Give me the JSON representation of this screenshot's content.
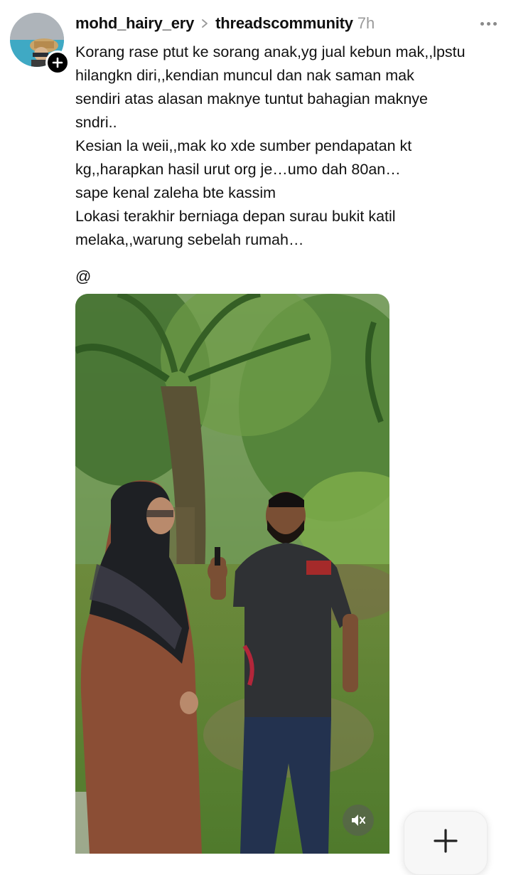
{
  "post": {
    "username": "mohd_hairy_ery",
    "community": "threadscommunity",
    "time": "7h",
    "text": "Korang rase ptut ke sorang anak,yg jual kebun mak,,lpstu\nhilangkn diri,,kendian muncul dan nak saman mak\nsendiri atas alasan maknye tuntut bahagian maknye\nsndri..\nKesian la weii,,mak ko xde sumber pendapatan kt\nkg,,harapkan hasil urut org je…umo dah 80an…\nsape kenal zaleha bte kassim\nLokasi terakhir berniaga depan surau bukit katil\nmelaka,,warung sebelah rumah…",
    "mention": "@"
  },
  "icons": {
    "separator": "chevron-right-icon",
    "more": "more-horizontal-icon",
    "follow": "plus-icon",
    "mute": "speaker-muted-icon",
    "compose": "plus-icon"
  },
  "colors": {
    "text": "#101010",
    "muted": "#9a9a9a",
    "badge": "#000000"
  }
}
